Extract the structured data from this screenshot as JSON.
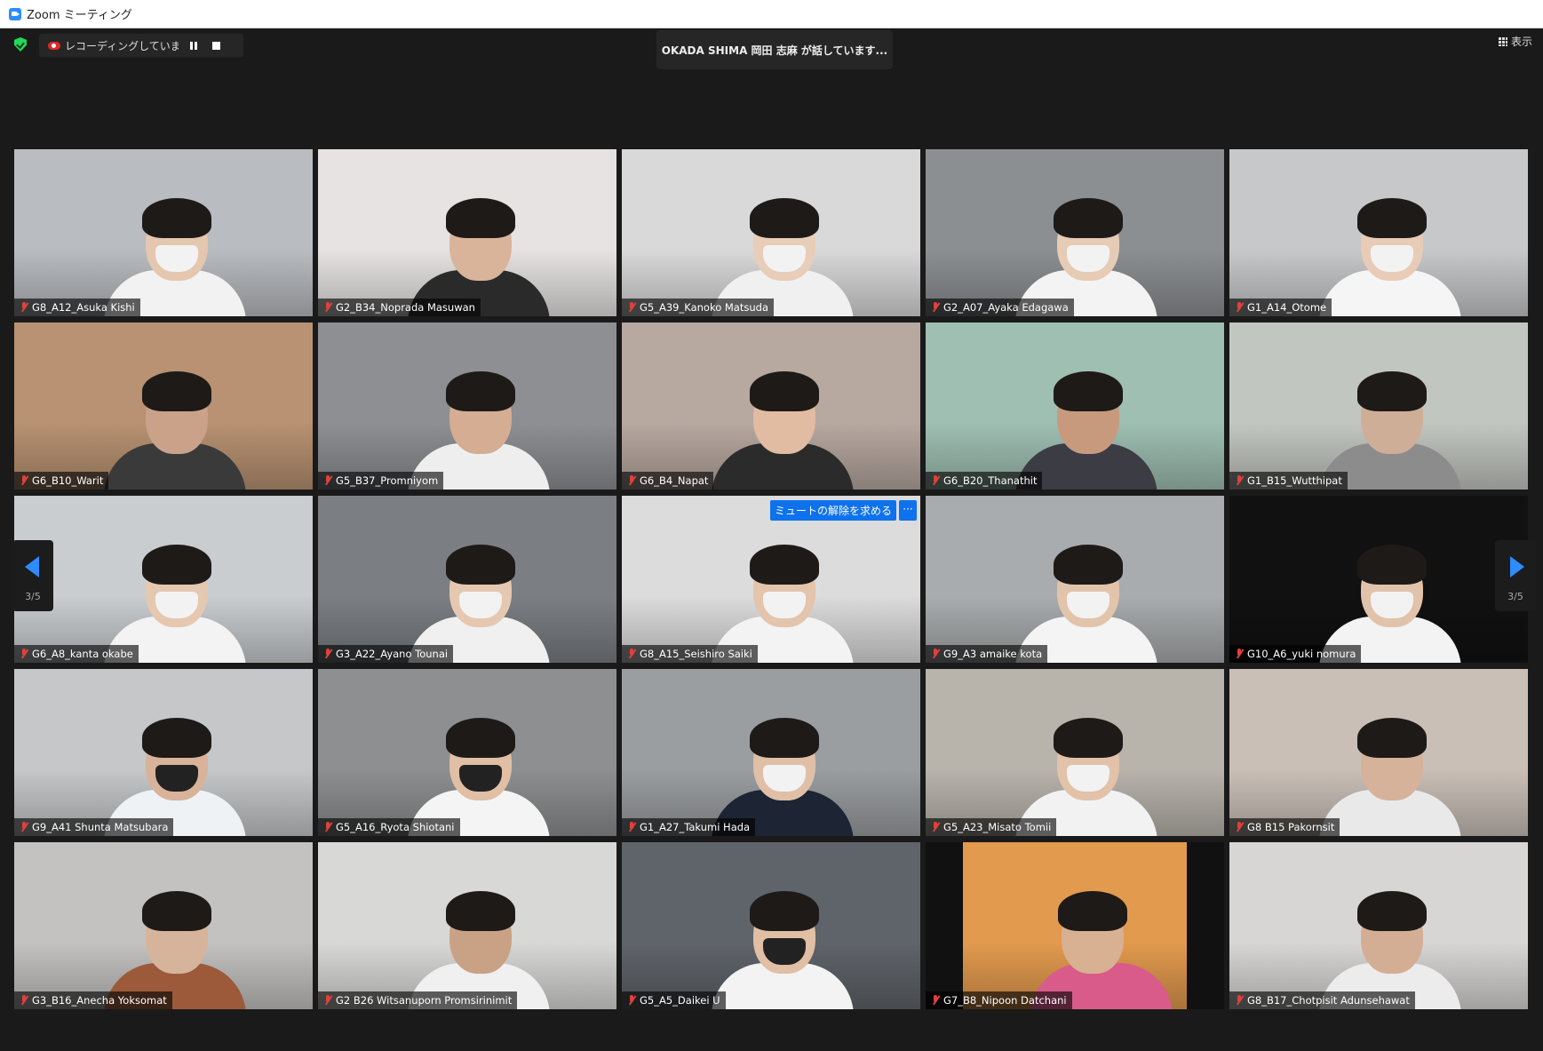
{
  "window": {
    "title": "Zoom ミーティング"
  },
  "toolbar": {
    "recording_text": "レコーディングしています...",
    "speaker_text": "OKADA SHIMA 岡田 志麻 が話しています...",
    "view_label": "表示"
  },
  "navigation": {
    "page_left": "3/5",
    "page_right": "3/5"
  },
  "unmute_request": {
    "label": "ミュートの解除を求める",
    "more": "···"
  },
  "participants": [
    {
      "name": "G8_A12_Asuka Kishi",
      "bg": "#b9bcc0",
      "skin": "#e4c7ae",
      "mask": "white",
      "shirt": "#f2f2f2"
    },
    {
      "name": "G2_B34_Noprada Masuwan",
      "bg": "#e6e3e2",
      "skin": "#d9b49a",
      "mask": "none",
      "shirt": "#2a2a2a"
    },
    {
      "name": "G5_A39_Kanoko Matsuda",
      "bg": "#d9d9da",
      "skin": "#e8cdb8",
      "mask": "white",
      "shirt": "#f0f0f0"
    },
    {
      "name": "G2_A07_Ayaka Edagawa",
      "bg": "#8c8f92",
      "skin": "#e6cbb5",
      "mask": "white",
      "shirt": "#f3f3f3"
    },
    {
      "name": "G1_A14_Otome",
      "bg": "#c7c8ca",
      "skin": "#e8ccb7",
      "mask": "white",
      "shirt": "#f5f5f5"
    },
    {
      "name": "G6_B10_Warit",
      "bg": "#b89272",
      "skin": "#caa28a",
      "mask": "none",
      "shirt": "#3a3a3a"
    },
    {
      "name": "G5_B37_Promniyom",
      "bg": "#8d8f93",
      "skin": "#d4ad92",
      "mask": "none",
      "shirt": "#eeeeee"
    },
    {
      "name": "G6_B4_Napat",
      "bg": "#b7a8a0",
      "skin": "#e1bba2",
      "mask": "none",
      "shirt": "#2b2b2b"
    },
    {
      "name": "G6_B20_Thanathit",
      "bg": "#9fbfb3",
      "skin": "#c79a7e",
      "mask": "none",
      "shirt": "#3c3c44"
    },
    {
      "name": "G1_B15_Wutthipat",
      "bg": "#c2c6c0",
      "skin": "#cfae98",
      "mask": "none",
      "shirt": "#8c8c8c"
    },
    {
      "name": "G6_A8_kanta okabe",
      "bg": "#c9cdd0",
      "skin": "#e5c8b0",
      "mask": "white",
      "shirt": "#f3f3f3"
    },
    {
      "name": "G3_A22_Ayano Tounai",
      "bg": "#7b7f83",
      "skin": "#e5c8b1",
      "mask": "white",
      "shirt": "#f0f0f0"
    },
    {
      "name": "G8_A15_Seishiro Saiki",
      "bg": "#dcdcdc",
      "skin": "#e3c4ac",
      "mask": "white",
      "shirt": "#f3f3f3"
    },
    {
      "name": "G9_A3 amaike kota",
      "bg": "#a9acae",
      "skin": "#e2c4ab",
      "mask": "white",
      "shirt": "#f4f4f4"
    },
    {
      "name": "G10_A6_yuki nomura",
      "bg": "#111111",
      "skin": "#e1c2aa",
      "mask": "white",
      "shirt": "#f3f3f3"
    },
    {
      "name": "G9_A41 Shunta Matsubara",
      "bg": "#c5c7c9",
      "skin": "#d8b39a",
      "mask": "black",
      "shirt": "#eef2f5"
    },
    {
      "name": "G5_A16_Ryota Shiotani",
      "bg": "#8e8f91",
      "skin": "#e0bfa4",
      "mask": "black",
      "shirt": "#f4f4f4"
    },
    {
      "name": "G1_A27_Takumi Hada",
      "bg": "#9b9ea1",
      "skin": "#dfc0a6",
      "mask": "white",
      "shirt": "#1d2433"
    },
    {
      "name": "G5_A23_Misato Tomii",
      "bg": "#b8b4ac",
      "skin": "#e2c2a8",
      "mask": "white",
      "shirt": "#f2f2f2"
    },
    {
      "name": "G8 B15 Pakornsit",
      "bg": "#c9bfb7",
      "skin": "#d6b29a",
      "mask": "none",
      "shirt": "#e9e9e9"
    },
    {
      "name": "G3_B16_Anecha Yoksomat",
      "bg": "#c3c2c0",
      "skin": "#d6b39b",
      "mask": "none",
      "shirt": "#9c5a3a"
    },
    {
      "name": "G2 B26 Witsanuporn Promsirinimit",
      "bg": "#d8d8d6",
      "skin": "#c9a286",
      "mask": "none",
      "shirt": "#f0f0f0"
    },
    {
      "name": "G5_A5_Daikei U",
      "bg": "#5f646a",
      "skin": "#e0bfa5",
      "mask": "black",
      "shirt": "#f3f3f3"
    },
    {
      "name": "G7_B8_Nipoon Datchani",
      "bg": "#e29a4e",
      "skin": "#d8b092",
      "mask": "none",
      "shirt": "#d95b8a",
      "framed": true
    },
    {
      "name": "G8_B17_Chotpisit Adunsehawat",
      "bg": "#d7d6d4",
      "skin": "#d4ae94",
      "mask": "none",
      "shirt": "#ececec"
    }
  ]
}
